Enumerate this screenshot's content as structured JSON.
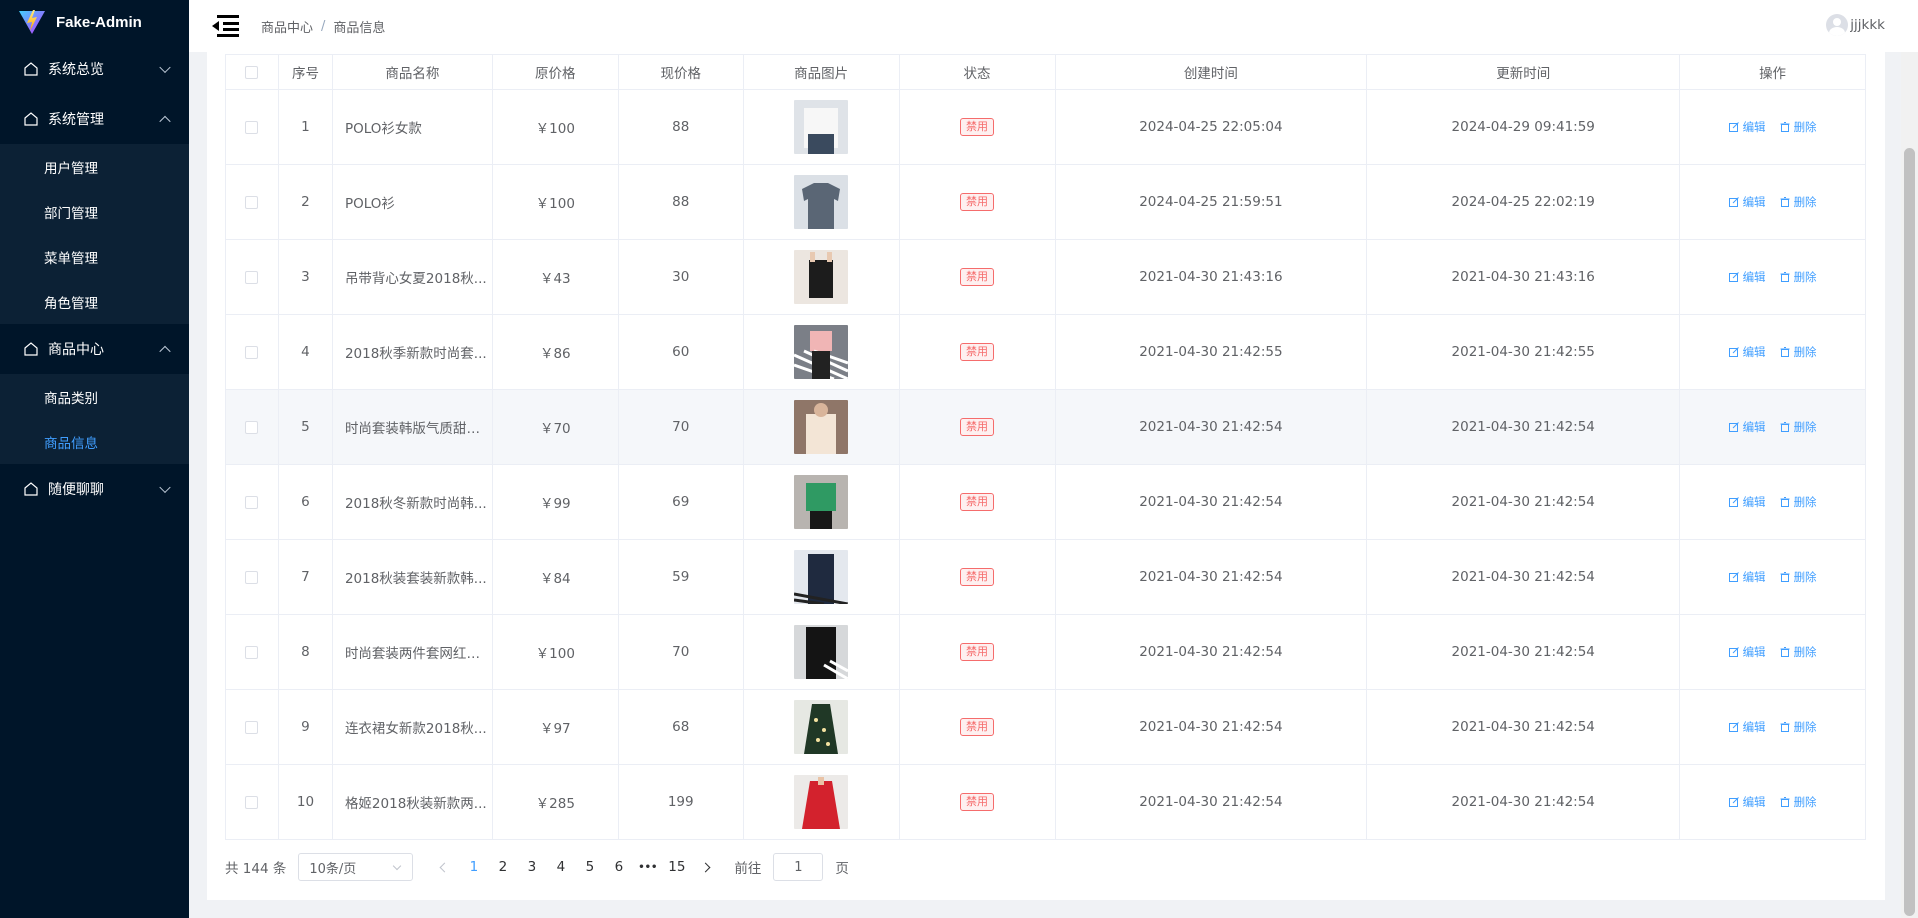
{
  "app": {
    "name": "Fake-Admin"
  },
  "sidebar": {
    "groups": [
      {
        "label": "系统总览",
        "expanded": false,
        "items": []
      },
      {
        "label": "系统管理",
        "expanded": true,
        "items": [
          "用户管理",
          "部门管理",
          "菜单管理",
          "角色管理"
        ]
      },
      {
        "label": "商品中心",
        "expanded": true,
        "items": [
          "商品类别",
          "商品信息"
        ]
      },
      {
        "label": "随便聊聊",
        "expanded": false,
        "items": []
      }
    ],
    "active_item": "商品信息"
  },
  "header": {
    "breadcrumb": [
      "商品中心",
      "商品信息"
    ],
    "breadcrumb_separator": "/",
    "username": "jjjkkk"
  },
  "table": {
    "headers": [
      "序号",
      "商品名称",
      "原价格",
      "现价格",
      "商品图片",
      "状态",
      "创建时间",
      "更新时间",
      "操作"
    ],
    "rows": [
      {
        "idx": "1",
        "name": "POLO衫女款",
        "orig": "￥100",
        "now": "88",
        "status": "禁用",
        "created": "2024-04-25 22:05:04",
        "updated": "2024-04-29 09:41:59",
        "img": "white-top"
      },
      {
        "idx": "2",
        "name": "POLO衫",
        "orig": "￥100",
        "now": "88",
        "status": "禁用",
        "created": "2024-04-25 21:59:51",
        "updated": "2024-04-25 22:02:19",
        "img": "grey-polo"
      },
      {
        "idx": "3",
        "name": "吊带背心女夏2018秋...",
        "orig": "￥43",
        "now": "30",
        "status": "禁用",
        "created": "2021-04-30 21:43:16",
        "updated": "2021-04-30 21:43:16",
        "img": "black-tank"
      },
      {
        "idx": "4",
        "name": "2018秋季新款时尚套...",
        "orig": "￥86",
        "now": "60",
        "status": "禁用",
        "created": "2021-04-30 21:42:55",
        "updated": "2021-04-30 21:42:55",
        "img": "striped-set"
      },
      {
        "idx": "5",
        "name": "时尚套装韩版气质甜美...",
        "orig": "￥70",
        "now": "70",
        "status": "禁用",
        "created": "2021-04-30 21:42:54",
        "updated": "2021-04-30 21:42:54",
        "img": "beige-knit"
      },
      {
        "idx": "6",
        "name": "2018秋冬新款时尚韩...",
        "orig": "￥99",
        "now": "69",
        "status": "禁用",
        "created": "2021-04-30 21:42:54",
        "updated": "2021-04-30 21:42:54",
        "img": "green-sweater"
      },
      {
        "idx": "7",
        "name": "2018秋装套装新款韩...",
        "orig": "￥84",
        "now": "59",
        "status": "禁用",
        "created": "2021-04-30 21:42:54",
        "updated": "2021-04-30 21:42:54",
        "img": "dark-suit"
      },
      {
        "idx": "8",
        "name": "时尚套装两件套网红同...",
        "orig": "￥100",
        "now": "70",
        "status": "禁用",
        "created": "2021-04-30 21:42:54",
        "updated": "2021-04-30 21:42:54",
        "img": "black-two-piece"
      },
      {
        "idx": "9",
        "name": "连衣裙女新款2018秋...",
        "orig": "￥97",
        "now": "68",
        "status": "禁用",
        "created": "2021-04-30 21:42:54",
        "updated": "2021-04-30 21:42:54",
        "img": "floral-dress"
      },
      {
        "idx": "10",
        "name": "格姬2018秋装新款两...",
        "orig": "￥285",
        "now": "199",
        "status": "禁用",
        "created": "2021-04-30 21:42:54",
        "updated": "2021-04-30 21:42:54",
        "img": "red-coat"
      }
    ],
    "actions": {
      "edit": "编辑",
      "delete": "删除"
    },
    "hover_row": 5
  },
  "pagination": {
    "total_text": "共 144 条",
    "page_size": "10条/页",
    "pages": [
      "1",
      "2",
      "3",
      "4",
      "5",
      "6"
    ],
    "ellipsis": "•••",
    "last_page": "15",
    "current": "1",
    "goto_label": "前往",
    "goto_value": "1",
    "goto_suffix": "页"
  },
  "colors": {
    "sidebar_bg": "#001529",
    "accent": "#409eff",
    "danger": "#f56c6c"
  }
}
